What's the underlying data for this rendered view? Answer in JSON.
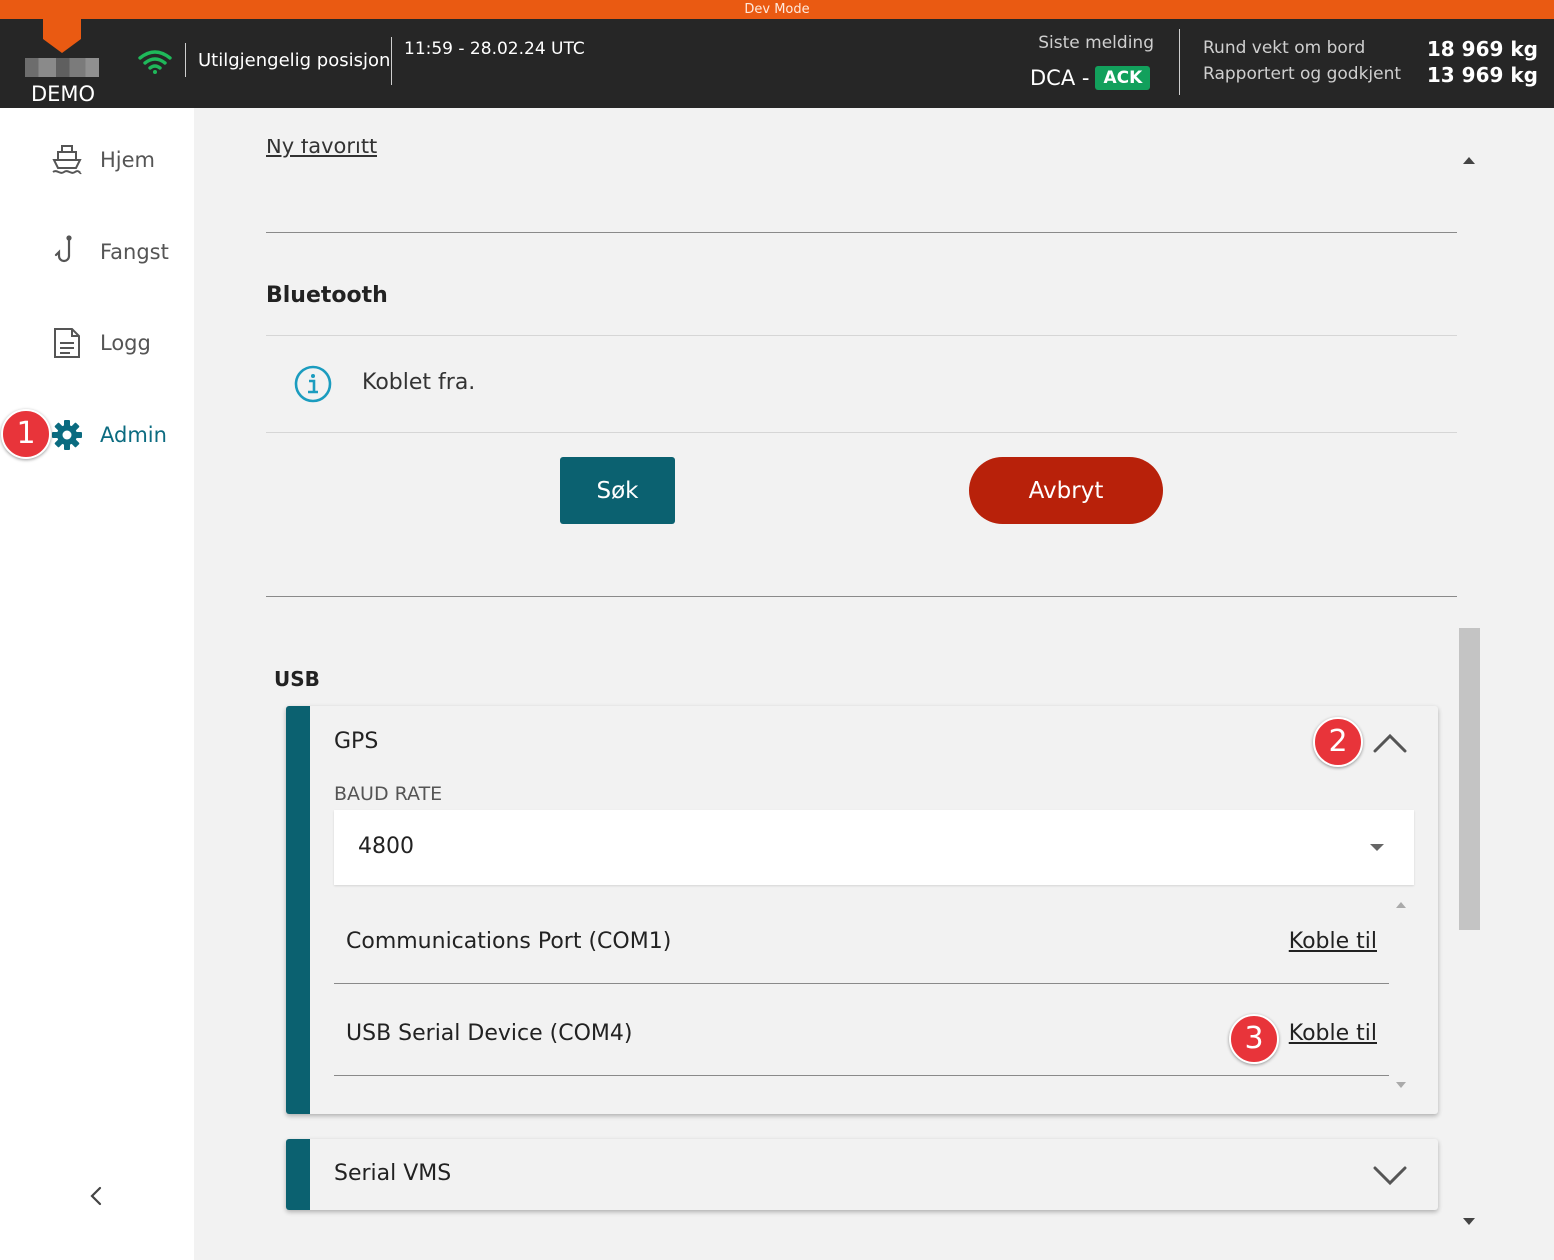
{
  "devbar": {
    "label": "Dev Mode"
  },
  "header": {
    "demo_label": "DEMO",
    "position_status": "Utilgjengelig posisjon",
    "datetime": "11:59 - 28.02.24 UTC",
    "last_message_label": "Siste melding",
    "last_message_type": "DCA -",
    "last_message_status": "ACK",
    "weight_onboard_label": "Rund vekt om bord",
    "weight_onboard_value": "18 969 kg",
    "weight_reported_label": "Rapportert og godkjent",
    "weight_reported_value": "13 969 kg"
  },
  "sidebar": {
    "items": [
      {
        "label": "Hjem",
        "icon": "boat-icon"
      },
      {
        "label": "Fangst",
        "icon": "fishhook-icon"
      },
      {
        "label": "Logg",
        "icon": "document-icon"
      },
      {
        "label": "Admin",
        "icon": "gear-icon",
        "active": true
      }
    ]
  },
  "badges": {
    "one": "1",
    "two": "2",
    "three": "3"
  },
  "main": {
    "favorite_link": "Ny favoritt",
    "bluetooth": {
      "title": "Bluetooth",
      "status": "Koblet fra.",
      "search_button": "Søk",
      "cancel_button": "Avbryt"
    },
    "usb": {
      "title": "USB",
      "gps": {
        "title": "GPS",
        "baud_label": "BAUD RATE",
        "baud_value": "4800",
        "ports": [
          {
            "name": "Communications Port (COM1)",
            "action": "Koble til"
          },
          {
            "name": "USB Serial Device (COM4)",
            "action": "Koble til"
          }
        ]
      },
      "serial_vms": {
        "title": "Serial VMS"
      }
    }
  },
  "colors": {
    "accent": "#0b6170",
    "danger": "#b8210a",
    "brand_orange": "#ea5a12",
    "ack_green": "#12a05c",
    "badge_red": "#e8343a"
  }
}
